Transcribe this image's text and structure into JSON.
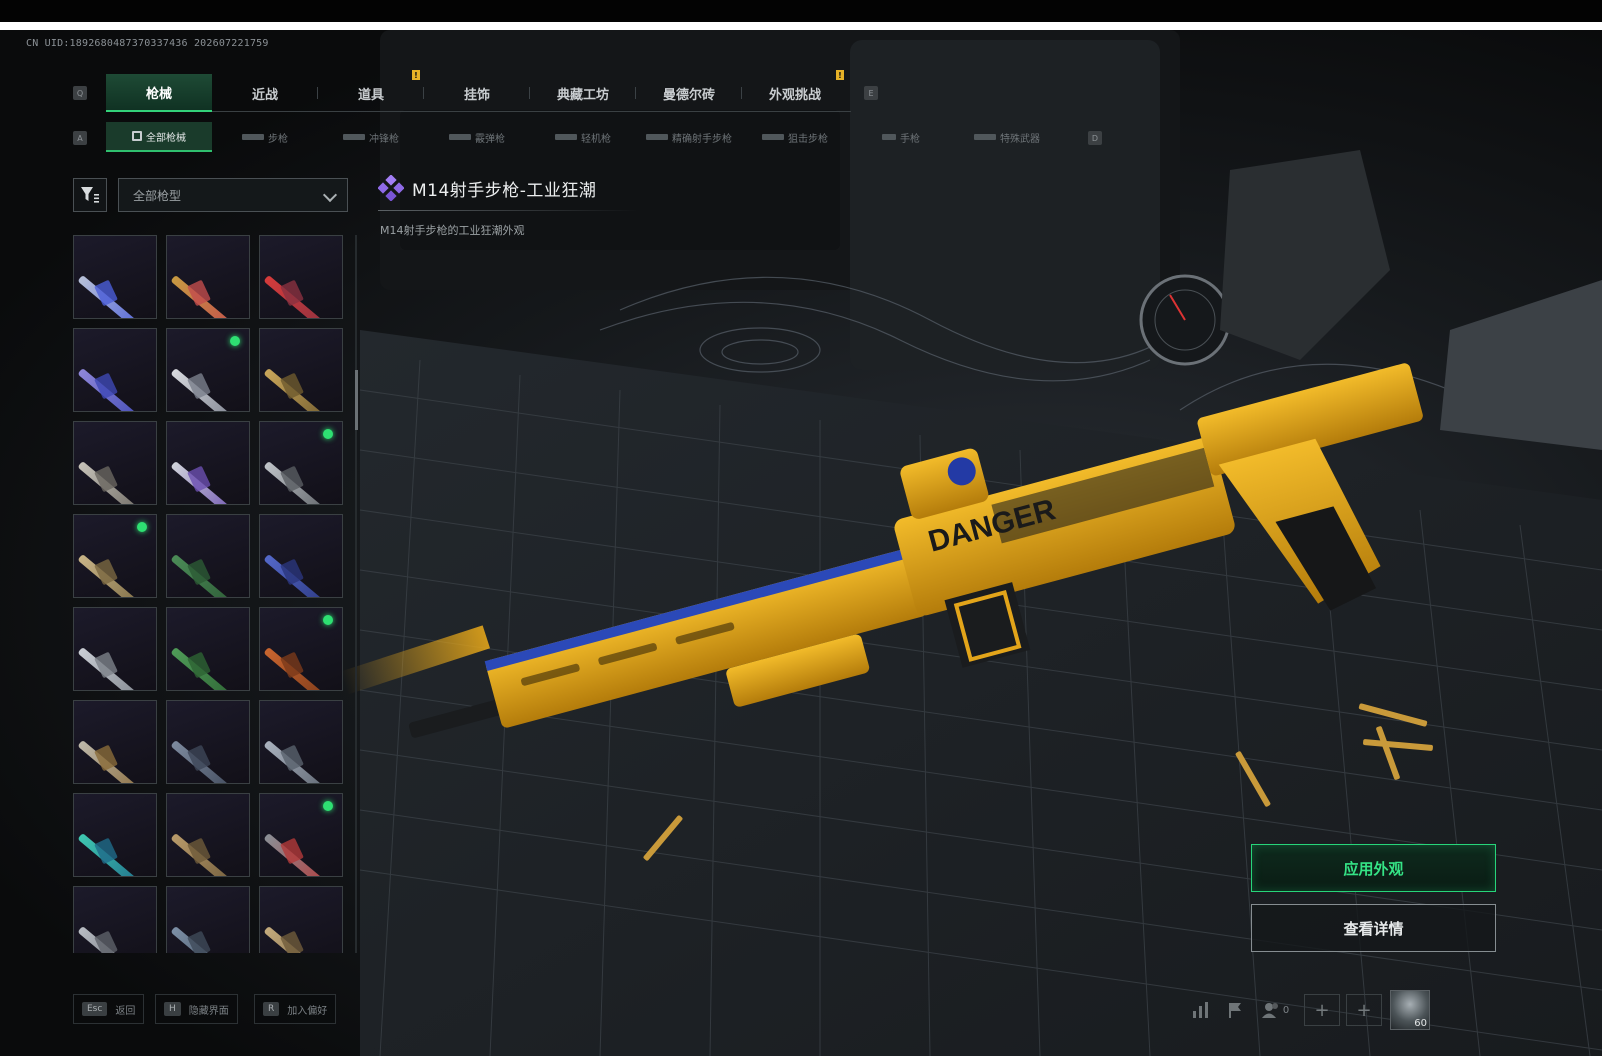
{
  "uid": "CN UID:1892680487370337436 202607221759",
  "primary_tabs": {
    "key_left": "Q",
    "key_right": "E",
    "items": [
      "枪械",
      "近战",
      "道具",
      "挂饰",
      "典藏工坊",
      "曼德尔砖",
      "外观挑战"
    ],
    "alert_label": "!"
  },
  "secondary_tabs": {
    "key_left": "A",
    "key_right": "D",
    "items": [
      "全部枪械",
      "步枪",
      "冲锋枪",
      "霰弹枪",
      "轻机枪",
      "精确射手步枪",
      "狙击步枪",
      "手枪",
      "特殊武器"
    ]
  },
  "filter": {
    "selected": "全部枪型"
  },
  "weapon": {
    "title": "M14射手步枪-工业狂潮",
    "description": "M14射手步枪的工业狂潮外观",
    "rarity_color": "#a37ef5",
    "livery_decal": "DANGER"
  },
  "grid": {
    "cells": [
      {
        "color": "#b7c0d8",
        "accent": "#4b5ed8",
        "dot": false
      },
      {
        "color": "#c79a42",
        "accent": "#c24c4c",
        "dot": false
      },
      {
        "color": "#d63b3b",
        "accent": "#8a3140",
        "dot": false
      },
      {
        "color": "#8e86d8",
        "accent": "#3f49b5",
        "dot": false
      },
      {
        "color": "#d7d9de",
        "accent": "#7a7f8c",
        "dot": true
      },
      {
        "color": "#c9a65a",
        "accent": "#6e5a2e",
        "dot": false
      },
      {
        "color": "#c6c2b8",
        "accent": "#6a6660",
        "dot": false
      },
      {
        "color": "#d0d3da",
        "accent": "#6b4fb0",
        "dot": false
      },
      {
        "color": "#bfc3c8",
        "accent": "#595d62",
        "dot": true
      },
      {
        "color": "#c8b487",
        "accent": "#7a6841",
        "dot": true
      },
      {
        "color": "#4b8b57",
        "accent": "#2c5a35",
        "dot": false
      },
      {
        "color": "#5468c9",
        "accent": "#2a367d",
        "dot": false
      },
      {
        "color": "#c9cdd4",
        "accent": "#7d828a",
        "dot": false
      },
      {
        "color": "#4f9b58",
        "accent": "#2d6333",
        "dot": false
      },
      {
        "color": "#c9652f",
        "accent": "#7a3a1a",
        "dot": true
      },
      {
        "color": "#bdb8aa",
        "accent": "#8a6b3a",
        "dot": false
      },
      {
        "color": "#7d8a9e",
        "accent": "#3d4658",
        "dot": false
      },
      {
        "color": "#a9b1bd",
        "accent": "#59616d",
        "dot": false
      },
      {
        "color": "#3fc7b0",
        "accent": "#1f6b8a",
        "dot": false
      },
      {
        "color": "#b89a6a",
        "accent": "#6e5a3a",
        "dot": false
      },
      {
        "color": "#8a8f96",
        "accent": "#b33a3a",
        "dot": true
      },
      {
        "color": "#b8bcc3",
        "accent": "#5e6269",
        "dot": false
      },
      {
        "color": "#7c8fa6",
        "accent": "#3e4a59",
        "dot": false
      },
      {
        "color": "#c4ab7d",
        "accent": "#6f5b3b",
        "dot": false
      }
    ]
  },
  "actions": {
    "apply": "应用外观",
    "detail": "查看详情"
  },
  "bottom_hints": [
    {
      "key": "Esc",
      "label": "返回"
    },
    {
      "key": "H",
      "label": "隐藏界面"
    },
    {
      "key": "R",
      "label": "加入偏好"
    }
  ],
  "bottom_right": {
    "party_count": "0",
    "avatar_level": "60"
  },
  "colors": {
    "accent_green": "#2ee072",
    "weapon_yellow": "#e3a51a"
  }
}
